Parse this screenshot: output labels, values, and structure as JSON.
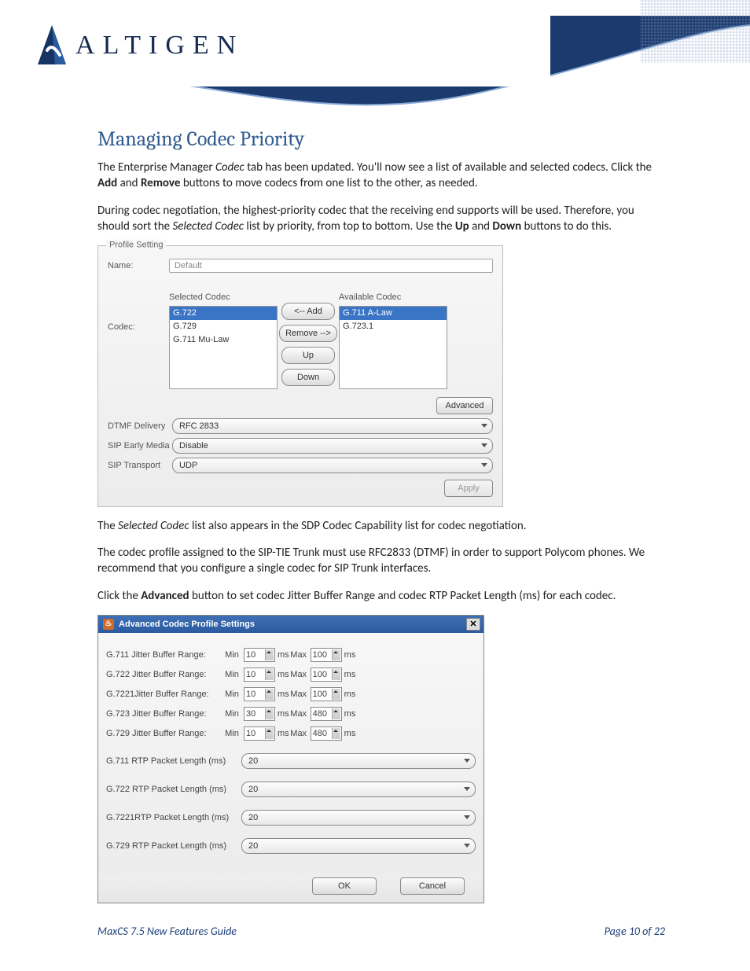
{
  "brand": {
    "name": "ALTIGEN"
  },
  "heading": "Managing Codec Priority",
  "para1_a": "The Enterprise Manager ",
  "para1_b": "Codec",
  "para1_c": " tab has been updated. You'll now see a list of available and selected codecs.  Click the ",
  "para1_d": "Add",
  "para1_e": " and ",
  "para1_f": "Remove",
  "para1_g": " buttons to move codecs from one list to the other, as needed.",
  "para2_a": "During codec negotiation, the highest-priority codec that the receiving end supports will be used.  Therefore, you should sort the ",
  "para2_b": "Selected Codec",
  "para2_c": " list by priority, from top to bottom. Use the ",
  "para2_d": "Up",
  "para2_e": " and ",
  "para2_f": "Down",
  "para2_g": " buttons to do this.",
  "para3_a": "The ",
  "para3_b": "Selected Codec",
  "para3_c": " list also appears in the SDP Codec Capability list for codec negotiation.",
  "para4": "The codec profile assigned to the SIP-TIE Trunk must use RFC2833 (DTMF) in order to support Polycom phones. We recommend that you configure a single codec for SIP Trunk interfaces.",
  "para5_a": "Click the ",
  "para5_b": "Advanced",
  "para5_c": " button to set codec Jitter Buffer Range and codec RTP Packet Length (ms) for each codec.",
  "profile": {
    "legend": "Profile Setting",
    "name_label": "Name:",
    "name_value": "Default",
    "codec_label": "Codec:",
    "selected_title": "Selected Codec",
    "available_title": "Available Codec",
    "selected": [
      "G.722",
      "G.729",
      "G.711 Mu-Law"
    ],
    "available": [
      "G.711 A-Law",
      "G.723.1"
    ],
    "btn_add": "<-- Add",
    "btn_remove": "Remove -->",
    "btn_up": "Up",
    "btn_down": "Down",
    "btn_advanced": "Advanced",
    "dtmf_label": "DTMF Delivery",
    "dtmf_value": "RFC 2833",
    "early_label": "SIP Early Media",
    "early_value": "Disable",
    "transport_label": "SIP Transport",
    "transport_value": "UDP",
    "btn_apply": "Apply"
  },
  "adv": {
    "title": "Advanced Codec Profile Settings",
    "min": "Min",
    "max": "Max",
    "ms": "ms",
    "jitter": [
      {
        "label": "G.711 Jitter Buffer Range:",
        "min": "10",
        "max": "100"
      },
      {
        "label": "G.722 Jitter Buffer Range:",
        "min": "10",
        "max": "100"
      },
      {
        "label": "G.7221Jitter Buffer Range:",
        "min": "10",
        "max": "100"
      },
      {
        "label": "G.723 Jitter Buffer Range:",
        "min": "30",
        "max": "480"
      },
      {
        "label": "G.729 Jitter Buffer Range:",
        "min": "10",
        "max": "480"
      }
    ],
    "packet": [
      {
        "label": "G.711 RTP Packet Length (ms)",
        "value": "20"
      },
      {
        "label": "G.722 RTP Packet Length (ms)",
        "value": "20"
      },
      {
        "label": "G.7221RTP Packet Length (ms)",
        "value": "20"
      },
      {
        "label": "G.729 RTP Packet Length (ms)",
        "value": "20"
      }
    ],
    "ok": "OK",
    "cancel": "Cancel"
  },
  "footer": {
    "title": "MaxCS 7.5 New Features Guide",
    "page": "Page 10 of 22"
  }
}
